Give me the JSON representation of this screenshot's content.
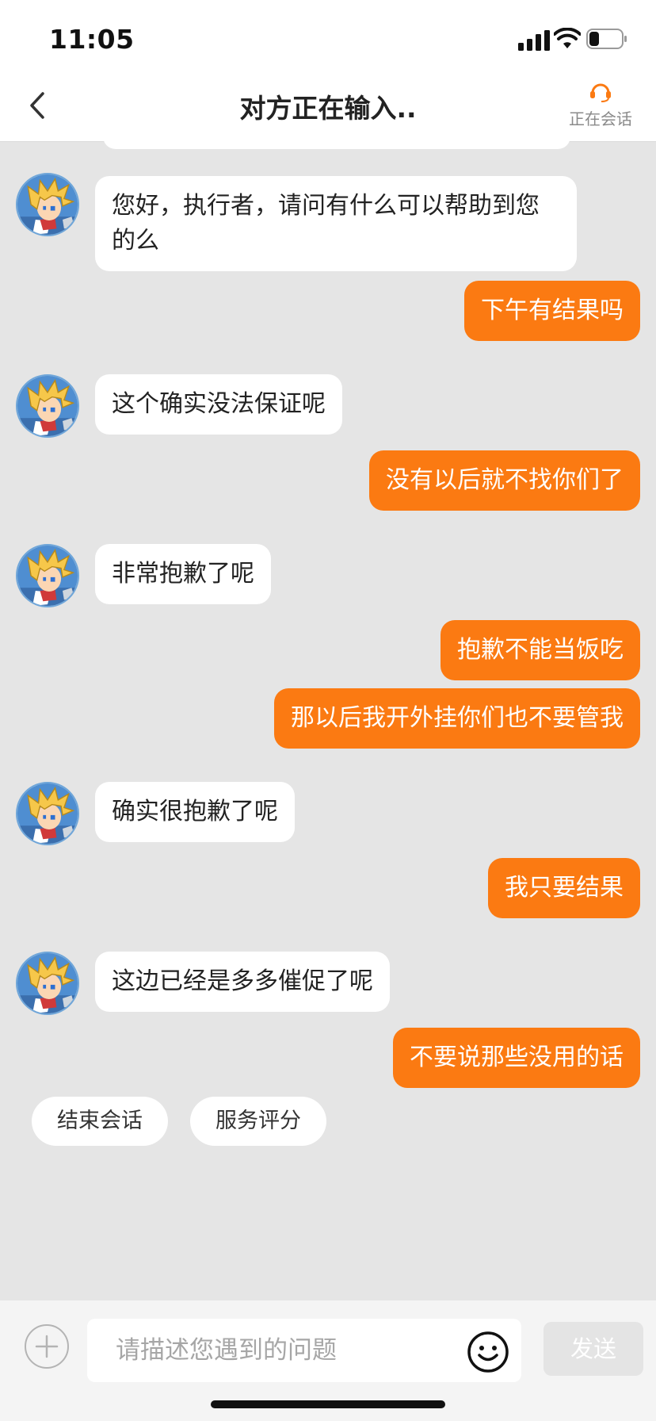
{
  "status_bar": {
    "time": "11:05",
    "battery_level": 0.3
  },
  "header": {
    "title": "对方正在输入..",
    "agent_status": "正在会话"
  },
  "messages": [
    {
      "side": "left",
      "text": "您好，执行者，请问有什么可以帮助到您的么"
    },
    {
      "side": "right",
      "text": "下午有结果吗"
    },
    {
      "side": "left",
      "text": "这个确实没法保证呢"
    },
    {
      "side": "right",
      "text": "没有以后就不找你们了"
    },
    {
      "side": "left",
      "text": "非常抱歉了呢"
    },
    {
      "side": "right",
      "text": "抱歉不能当饭吃"
    },
    {
      "side": "right",
      "text": "那以后我开外挂你们也不要管我"
    },
    {
      "side": "left",
      "text": "确实很抱歉了呢"
    },
    {
      "side": "right",
      "text": "我只要结果"
    },
    {
      "side": "left",
      "text": "这边已经是多多催促了呢"
    },
    {
      "side": "right",
      "text": "不要说那些没用的话"
    }
  ],
  "quick_actions": [
    {
      "label": "结束会话"
    },
    {
      "label": "服务评分"
    }
  ],
  "composer": {
    "placeholder": "请描述您遇到的问题",
    "send_label": "发送"
  },
  "colors": {
    "accent": "#fb7a12",
    "background": "#e5e5e5",
    "send_disabled": "#e4e4e4"
  }
}
